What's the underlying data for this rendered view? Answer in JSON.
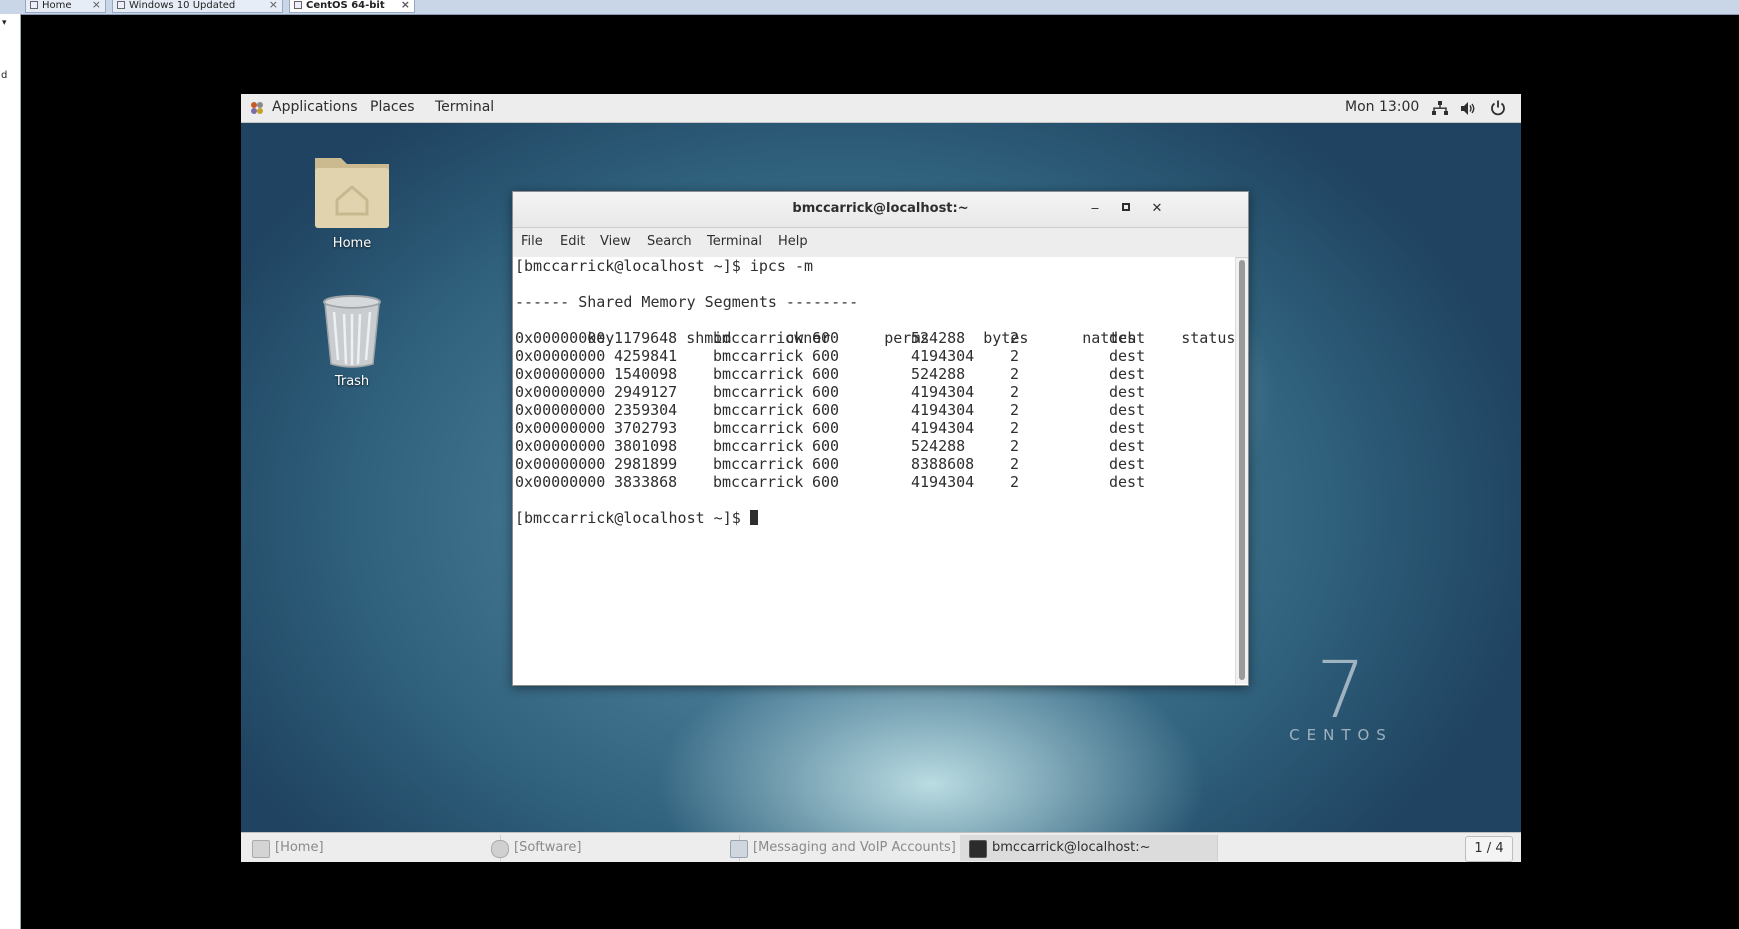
{
  "host": {
    "tabs": [
      {
        "label": "Home"
      },
      {
        "label": "Windows 10 Updated"
      },
      {
        "label": "CentOS 64-bit"
      }
    ],
    "close_glyph": "×"
  },
  "topbar": {
    "applications": "Applications",
    "places": "Places",
    "terminal": "Terminal",
    "clock": "Mon 13:00"
  },
  "desktop": {
    "home_label": "Home",
    "trash_label": "Trash"
  },
  "terminal": {
    "title": "bmccarrick@localhost:~",
    "menu": [
      "File",
      "Edit",
      "View",
      "Search",
      "Terminal",
      "Help"
    ],
    "prompt": "[bmccarrick@localhost ~]$ ",
    "command": "ipcs -m",
    "section_header": "------ Shared Memory Segments --------",
    "columns": [
      "key",
      "shmid",
      "owner",
      "perms",
      "bytes",
      "nattch",
      "status"
    ],
    "rows": [
      [
        "0x00000000",
        "1179648",
        "bmccarrick",
        "600",
        "524288",
        "2",
        "dest"
      ],
      [
        "0x00000000",
        "4259841",
        "bmccarrick",
        "600",
        "4194304",
        "2",
        "dest"
      ],
      [
        "0x00000000",
        "1540098",
        "bmccarrick",
        "600",
        "524288",
        "2",
        "dest"
      ],
      [
        "0x00000000",
        "2949127",
        "bmccarrick",
        "600",
        "4194304",
        "2",
        "dest"
      ],
      [
        "0x00000000",
        "2359304",
        "bmccarrick",
        "600",
        "4194304",
        "2",
        "dest"
      ],
      [
        "0x00000000",
        "3702793",
        "bmccarrick",
        "600",
        "4194304",
        "2",
        "dest"
      ],
      [
        "0x00000000",
        "3801098",
        "bmccarrick",
        "600",
        "524288",
        "2",
        "dest"
      ],
      [
        "0x00000000",
        "2981899",
        "bmccarrick",
        "600",
        "8388608",
        "2",
        "dest"
      ],
      [
        "0x00000000",
        "3833868",
        "bmccarrick",
        "600",
        "4194304",
        "2",
        "dest"
      ]
    ]
  },
  "wallpaper": {
    "numeral": "7",
    "word": "CENTOS"
  },
  "taskbar": {
    "items": [
      {
        "label": "[Home]",
        "icon": "folder-icon"
      },
      {
        "label": "[Software]",
        "icon": "software-icon"
      },
      {
        "label": "[Messaging and VoIP Accounts]",
        "icon": "messaging-icon"
      },
      {
        "label": "bmccarrick@localhost:~",
        "icon": "terminal-icon"
      }
    ],
    "workspace": "1 / 4"
  },
  "colors": {
    "topbar_bg": "#ededed",
    "terminal_text": "#2e2e2e",
    "wallpaper_blue": "#2f607c"
  }
}
